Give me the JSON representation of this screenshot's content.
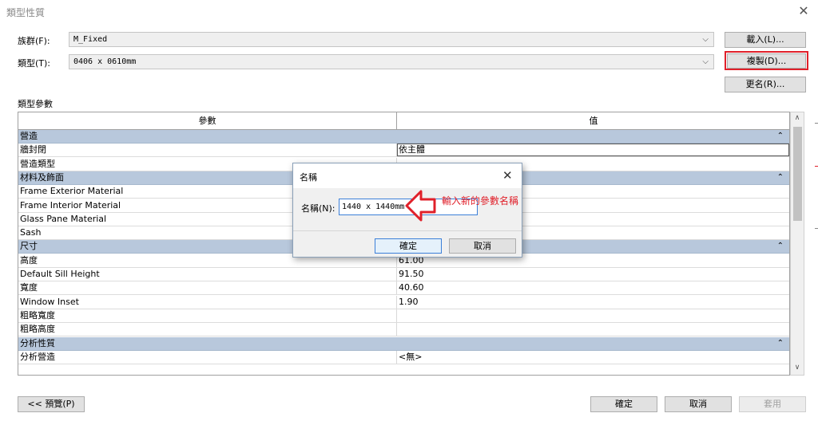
{
  "window": {
    "title": "類型性質",
    "close": "✕"
  },
  "family": {
    "label": "族群(F):",
    "value": "M_Fixed"
  },
  "type": {
    "label": "類型(T):",
    "value": "0406 x 0610mm"
  },
  "buttons": {
    "load": "載入(L)...",
    "duplicate": "複製(D)...",
    "rename": "更名(R)..."
  },
  "type_params_label": "類型參數",
  "grid": {
    "col_param": "參數",
    "col_value": "值",
    "rows": [
      {
        "kind": "group",
        "name": "營造"
      },
      {
        "kind": "row",
        "name": "牆封閉",
        "value": "依主體"
      },
      {
        "kind": "row",
        "name": "營造類型",
        "value": ""
      },
      {
        "kind": "group",
        "name": "材料及飾面"
      },
      {
        "kind": "row",
        "name": "Frame Exterior Material",
        "value": ""
      },
      {
        "kind": "row",
        "name": "Frame Interior Material",
        "value": ""
      },
      {
        "kind": "row",
        "name": "Glass Pane Material",
        "value": ""
      },
      {
        "kind": "row",
        "name": "Sash",
        "value": ""
      },
      {
        "kind": "group",
        "name": "尺寸"
      },
      {
        "kind": "row",
        "name": "高度",
        "value": "61.00"
      },
      {
        "kind": "row",
        "name": "Default Sill Height",
        "value": "91.50"
      },
      {
        "kind": "row",
        "name": "寬度",
        "value": "40.60"
      },
      {
        "kind": "row",
        "name": "Window Inset",
        "value": "1.90"
      },
      {
        "kind": "row",
        "name": "粗略寬度",
        "value": ""
      },
      {
        "kind": "row",
        "name": "粗略高度",
        "value": ""
      },
      {
        "kind": "group",
        "name": "分析性質"
      },
      {
        "kind": "row",
        "name": "分析營造",
        "value": "<無>"
      }
    ]
  },
  "footer": {
    "preview": "<< 預覽(P)",
    "ok": "確定",
    "cancel": "取消",
    "apply": "套用"
  },
  "name_dialog": {
    "title": "名稱",
    "label": "名稱(N):",
    "value": "1440 x 1440mm",
    "ok": "確定",
    "cancel": "取消"
  },
  "annotation": {
    "text": "輸入新的參數名稱",
    "color": "#e0202a"
  },
  "colors": {
    "group_band": "#b8c8dc",
    "highlight": "#e0202a",
    "focus": "#3c7fd8"
  }
}
